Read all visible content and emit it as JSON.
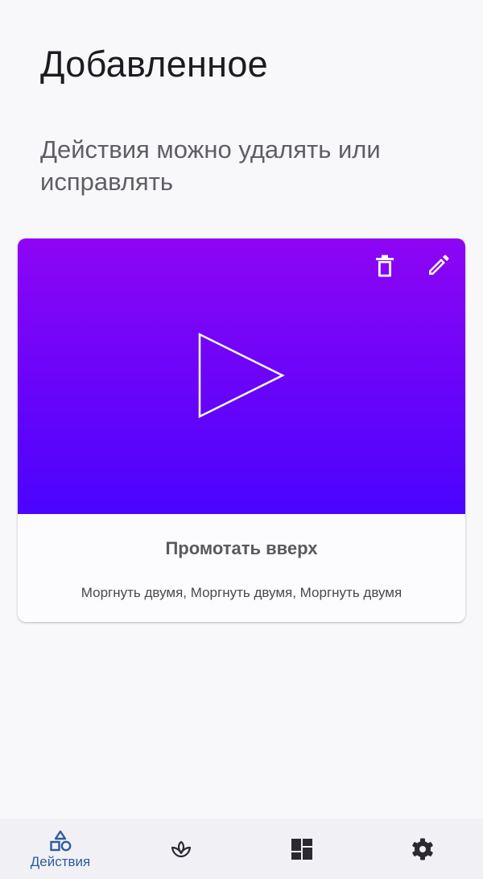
{
  "header": {
    "title": "Добавленное",
    "subtitle": "Действия можно удалять или исправлять"
  },
  "card": {
    "title": "Промотать вверх",
    "gestures": "Моргнуть двумя, Моргнуть двумя, Моргнуть двумя",
    "gradient_top": "#8e05f4",
    "gradient_bottom": "#4a04fe",
    "preview_icon": "play-icon",
    "actions": [
      {
        "icon": "delete-icon"
      },
      {
        "icon": "edit-icon"
      }
    ]
  },
  "bottom_nav": {
    "items": [
      {
        "icon": "shapes-icon",
        "label": "Действия",
        "active": true
      },
      {
        "icon": "sprout-icon",
        "label": "",
        "active": false
      },
      {
        "icon": "dashboard-icon",
        "label": "",
        "active": false
      },
      {
        "icon": "gear-icon",
        "label": "",
        "active": false
      }
    ],
    "active_color": "#2d5c9e",
    "icon_color": "#2b2a30"
  }
}
